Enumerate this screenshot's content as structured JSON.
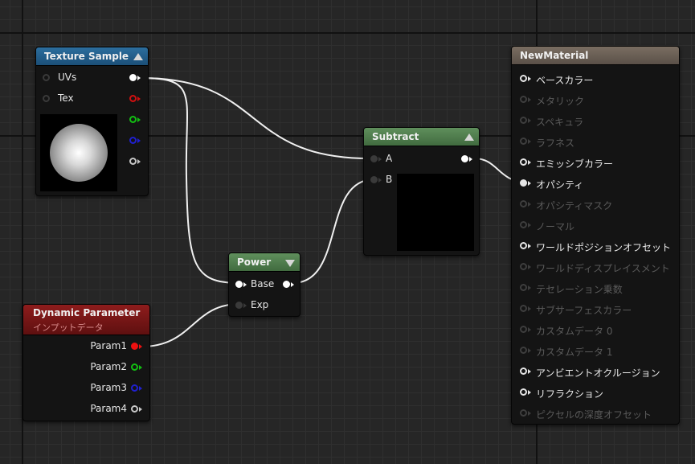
{
  "nodes": {
    "texture_sample": {
      "title": "Texture Sample",
      "inputs": [
        "UVs",
        "Tex"
      ],
      "output_colors": [
        "#ffffff",
        "#d01010",
        "#12c012",
        "#2020d0",
        "#c8c8c8"
      ]
    },
    "subtract": {
      "title": "Subtract",
      "inputs": [
        "A",
        "B"
      ]
    },
    "power": {
      "title": "Power",
      "inputs": [
        "Base",
        "Exp"
      ]
    },
    "dynamic_parameter": {
      "title": "Dynamic Parameter",
      "subtitle": "インプットデータ",
      "outputs": [
        "Param1",
        "Param2",
        "Param3",
        "Param4"
      ],
      "output_colors": [
        "#ee1111",
        "#12c012",
        "#2020d0",
        "#c8c8c8"
      ]
    },
    "new_material": {
      "title": "NewMaterial",
      "inputs": [
        {
          "label": "ベースカラー",
          "active": true
        },
        {
          "label": "メタリック",
          "active": false
        },
        {
          "label": "スペキュラ",
          "active": false
        },
        {
          "label": "ラフネス",
          "active": false
        },
        {
          "label": "エミッシブカラー",
          "active": true
        },
        {
          "label": "オパシティ",
          "active": true,
          "connected": true
        },
        {
          "label": "オパシティマスク",
          "active": false
        },
        {
          "label": "ノーマル",
          "active": false
        },
        {
          "label": "ワールドポジションオフセット",
          "active": true
        },
        {
          "label": "ワールドディスプレイスメント",
          "active": false
        },
        {
          "label": "テセレーション乗数",
          "active": false
        },
        {
          "label": "サブサーフェスカラー",
          "active": false
        },
        {
          "label": "カスタムデータ 0",
          "active": false
        },
        {
          "label": "カスタムデータ 1",
          "active": false
        },
        {
          "label": "アンビエントオクルージョン",
          "active": true
        },
        {
          "label": "リフラクション",
          "active": true
        },
        {
          "label": "ピクセルの深度オフセット",
          "active": false
        }
      ]
    }
  },
  "colors": {
    "texture_header": "#1f5a86",
    "subtract_header": "#4d7a4a",
    "power_header": "#4d7a4a",
    "dynamic_header": "#7a1414",
    "material_header": "#6d6258",
    "wire": "#f0f0f0"
  }
}
